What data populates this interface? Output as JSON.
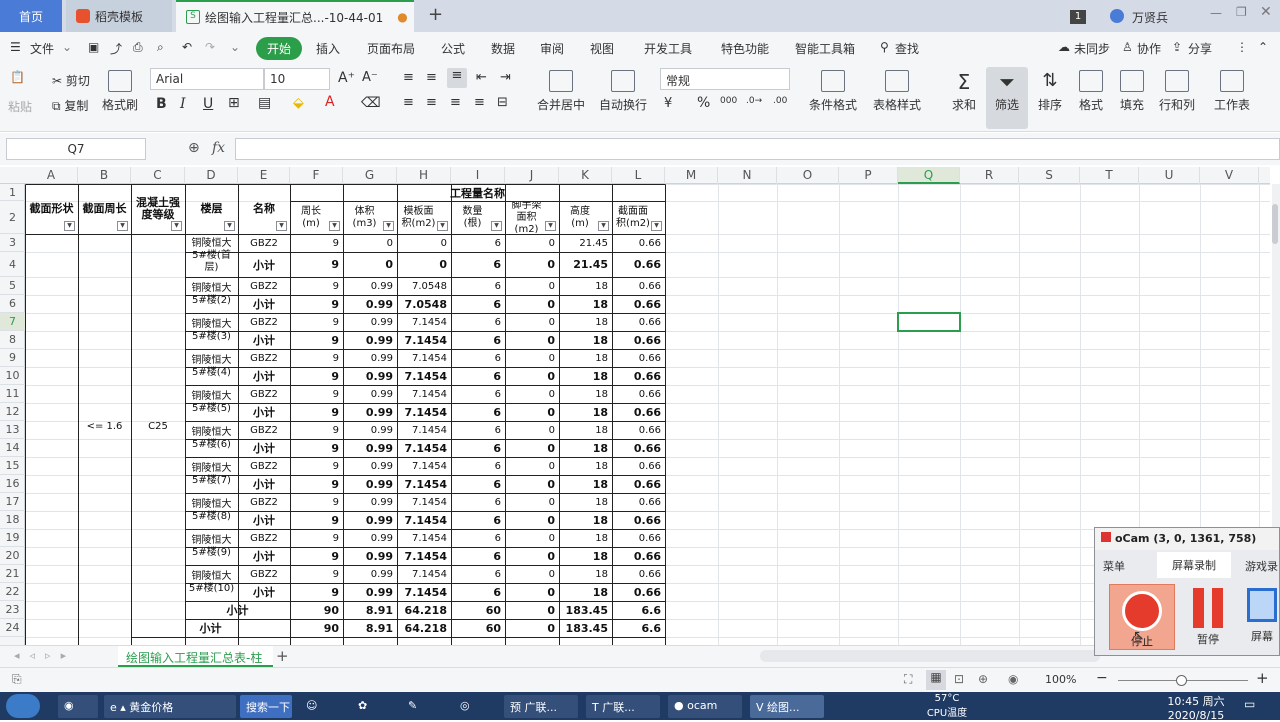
{
  "tabs": {
    "home": "首页",
    "template": "稻壳模板",
    "doc": "绘图输入工程量汇总...-10-44-01",
    "user": "万贤兵",
    "badge": "1"
  },
  "menu": [
    "文件",
    "开始",
    "插入",
    "页面布局",
    "公式",
    "数据",
    "审阅",
    "视图",
    "开发工具",
    "特色功能",
    "智能工具箱",
    "查找"
  ],
  "menu_right": {
    "sync": "未同步",
    "collab": "协作",
    "share": "分享"
  },
  "ribbon": {
    "cut": "剪切",
    "copy": "复制",
    "paste": "粘贴",
    "format_painter": "格式刷",
    "font": "Arial",
    "size": "10",
    "merge": "合并居中",
    "wrap": "自动换行",
    "numfmt": "常规",
    "cond": "条件格式",
    "table_style": "表格样式",
    "sum": "求和",
    "filter": "筛选",
    "sort": "排序",
    "format": "格式",
    "fill": "填充",
    "rowcol": "行和列",
    "sheet": "工作表"
  },
  "formula": {
    "namebox": "Q7",
    "fx": "fx"
  },
  "columns": [
    "A",
    "B",
    "C",
    "D",
    "E",
    "F",
    "G",
    "H",
    "I",
    "J",
    "K",
    "L",
    "M",
    "N",
    "O",
    "P",
    "Q",
    "R",
    "S",
    "T",
    "U",
    "V"
  ],
  "rows": [
    "1",
    "2",
    "3",
    "4",
    "5",
    "6",
    "7",
    "8",
    "9",
    "10",
    "11",
    "12",
    "13",
    "14",
    "15",
    "16",
    "17",
    "18",
    "19",
    "20",
    "21",
    "22",
    "23",
    "24"
  ],
  "table": {
    "title": "工程量名称",
    "headers": [
      "截面形状",
      "截面周长",
      "混凝土强度等级",
      "楼层",
      "名称",
      "周长(m)",
      "体积(m3)",
      "模板面积(m2)",
      "数量(根)",
      "脚手架面积(m2)",
      "高度(m)",
      "截面面积(m2)"
    ],
    "perimeter_group": "<= 1.6",
    "grade": "C25",
    "floors": [
      "铜陵恒大5#楼(首层)",
      "铜陵恒大5#楼(2)",
      "铜陵恒大5#楼(3)",
      "铜陵恒大5#楼(4)",
      "铜陵恒大5#楼(5)",
      "铜陵恒大5#楼(6)",
      "铜陵恒大5#楼(7)",
      "铜陵恒大5#楼(8)",
      "铜陵恒大5#楼(9)",
      "铜陵恒大5#楼(10)"
    ],
    "name_item": "GBZ2",
    "name_sub": "小计",
    "floor_rows": [
      {
        "item": [
          "9",
          "0",
          "0",
          "6",
          "0",
          "21.45",
          "0.66"
        ],
        "sub": [
          "9",
          "0",
          "0",
          "6",
          "0",
          "21.45",
          "0.66"
        ]
      },
      {
        "item": [
          "9",
          "0.99",
          "7.0548",
          "6",
          "0",
          "18",
          "0.66"
        ],
        "sub": [
          "9",
          "0.99",
          "7.0548",
          "6",
          "0",
          "18",
          "0.66"
        ]
      },
      {
        "item": [
          "9",
          "0.99",
          "7.1454",
          "6",
          "0",
          "18",
          "0.66"
        ],
        "sub": [
          "9",
          "0.99",
          "7.1454",
          "6",
          "0",
          "18",
          "0.66"
        ]
      },
      {
        "item": [
          "9",
          "0.99",
          "7.1454",
          "6",
          "0",
          "18",
          "0.66"
        ],
        "sub": [
          "9",
          "0.99",
          "7.1454",
          "6",
          "0",
          "18",
          "0.66"
        ]
      },
      {
        "item": [
          "9",
          "0.99",
          "7.1454",
          "6",
          "0",
          "18",
          "0.66"
        ],
        "sub": [
          "9",
          "0.99",
          "7.1454",
          "6",
          "0",
          "18",
          "0.66"
        ]
      },
      {
        "item": [
          "9",
          "0.99",
          "7.1454",
          "6",
          "0",
          "18",
          "0.66"
        ],
        "sub": [
          "9",
          "0.99",
          "7.1454",
          "6",
          "0",
          "18",
          "0.66"
        ]
      },
      {
        "item": [
          "9",
          "0.99",
          "7.1454",
          "6",
          "0",
          "18",
          "0.66"
        ],
        "sub": [
          "9",
          "0.99",
          "7.1454",
          "6",
          "0",
          "18",
          "0.66"
        ]
      },
      {
        "item": [
          "9",
          "0.99",
          "7.1454",
          "6",
          "0",
          "18",
          "0.66"
        ],
        "sub": [
          "9",
          "0.99",
          "7.1454",
          "6",
          "0",
          "18",
          "0.66"
        ]
      },
      {
        "item": [
          "9",
          "0.99",
          "7.1454",
          "6",
          "0",
          "18",
          "0.66"
        ],
        "sub": [
          "9",
          "0.99",
          "7.1454",
          "6",
          "0",
          "18",
          "0.66"
        ]
      },
      {
        "item": [
          "9",
          "0.99",
          "7.1454",
          "6",
          "0",
          "18",
          "0.66"
        ],
        "sub": [
          "9",
          "0.99",
          "7.1454",
          "6",
          "0",
          "18",
          "0.66"
        ]
      }
    ],
    "subtotal_label": "小计",
    "subtotal": [
      "90",
      "8.91",
      "64.218",
      "60",
      "0",
      "183.45",
      "6.6"
    ],
    "total_label": "小计",
    "total": [
      "90",
      "8.91",
      "64.218",
      "60",
      "0",
      "183.45",
      "6.6"
    ]
  },
  "sheet_tab": "绘图输入工程量汇总表-柱",
  "status": {
    "zoom": "100%"
  },
  "ocam": {
    "title": "oCam (3, 0, 1361, 758)",
    "tab_menu": "菜单",
    "tab_screen": "屏幕录制",
    "tab_game": "游戏录",
    "stop": "停止",
    "pause": "暂停",
    "screen": "屏幕"
  },
  "taskbar": {
    "gold": "黄金价格",
    "search": "搜索一下",
    "gl1": "广联...",
    "gl2": "广联...",
    "ocam": "ocam",
    "draw": "绘图...",
    "temp": "57°C",
    "temp_label": "CPU温度",
    "time": "10:45 周六",
    "date": "2020/8/15"
  },
  "colors": {
    "green": "#2b9e4e",
    "selected": "#2b9e4e",
    "header_bg": "#f4f5f7"
  }
}
